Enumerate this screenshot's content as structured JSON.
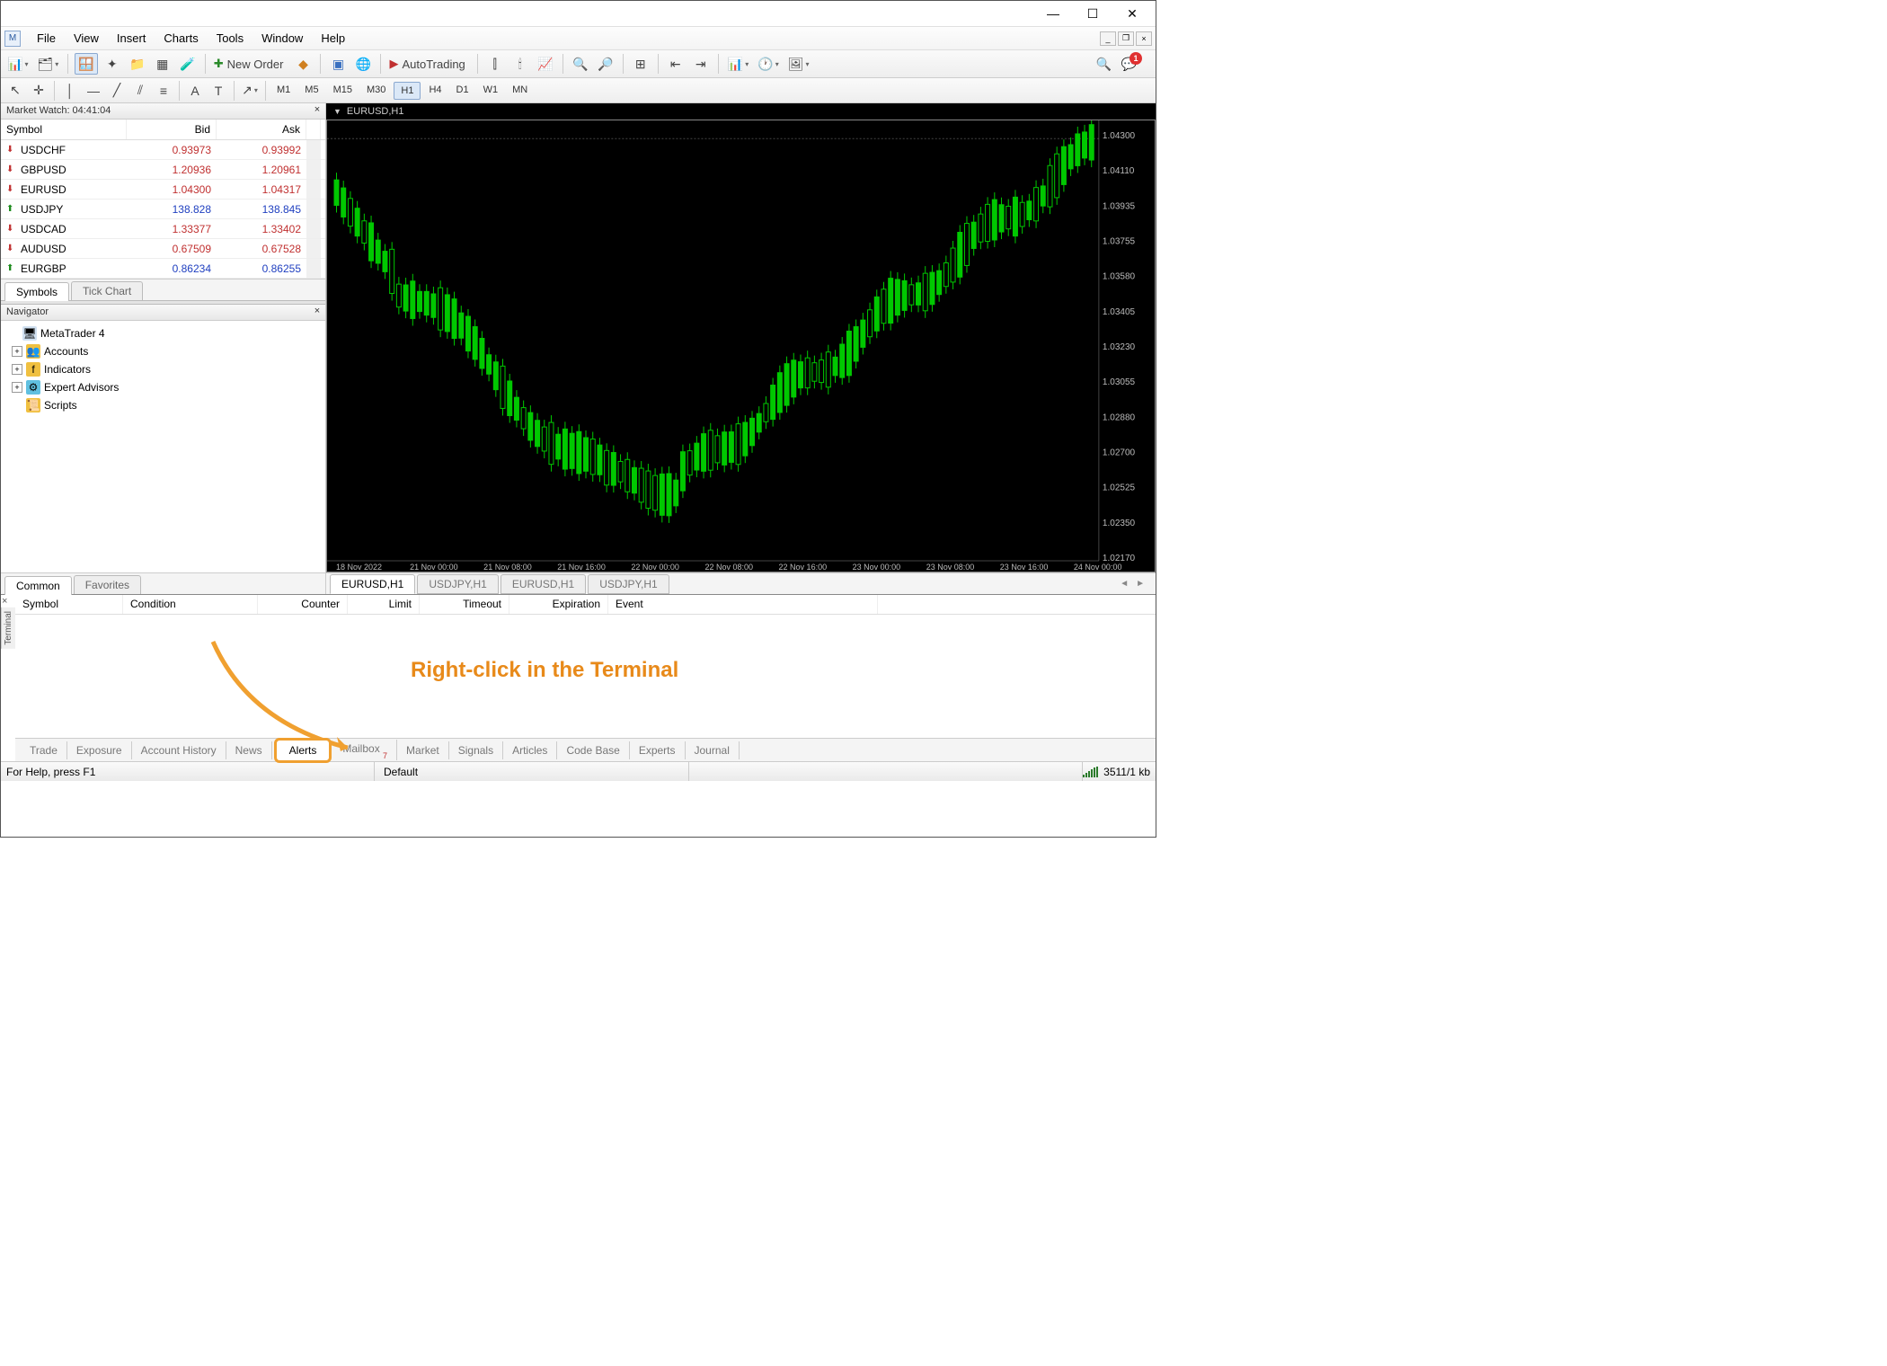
{
  "menu": {
    "items": [
      "File",
      "View",
      "Insert",
      "Charts",
      "Tools",
      "Window",
      "Help"
    ]
  },
  "toolbar": {
    "new_order": "New Order",
    "autotrading": "AutoTrading",
    "notif_count": "1"
  },
  "timeframes": [
    "M1",
    "M5",
    "M15",
    "M30",
    "H1",
    "H4",
    "D1",
    "W1",
    "MN"
  ],
  "timeframe_active": "H1",
  "market_watch": {
    "title": "Market Watch: 04:41:04",
    "cols": {
      "symbol": "Symbol",
      "bid": "Bid",
      "ask": "Ask"
    },
    "rows": [
      {
        "dir": "dn",
        "sym": "USDCHF",
        "bid": "0.93973",
        "ask": "0.93992",
        "cls": "red"
      },
      {
        "dir": "dn",
        "sym": "GBPUSD",
        "bid": "1.20936",
        "ask": "1.20961",
        "cls": "red"
      },
      {
        "dir": "dn",
        "sym": "EURUSD",
        "bid": "1.04300",
        "ask": "1.04317",
        "cls": "red"
      },
      {
        "dir": "up",
        "sym": "USDJPY",
        "bid": "138.828",
        "ask": "138.845",
        "cls": "blue"
      },
      {
        "dir": "dn",
        "sym": "USDCAD",
        "bid": "1.33377",
        "ask": "1.33402",
        "cls": "red"
      },
      {
        "dir": "dn",
        "sym": "AUDUSD",
        "bid": "0.67509",
        "ask": "0.67528",
        "cls": "red"
      },
      {
        "dir": "up",
        "sym": "EURGBP",
        "bid": "0.86234",
        "ask": "0.86255",
        "cls": "blue"
      }
    ],
    "tabs": [
      "Symbols",
      "Tick Chart"
    ]
  },
  "navigator": {
    "title": "Navigator",
    "items": [
      {
        "exp": false,
        "icon": "🖥",
        "label": "MetaTrader 4"
      },
      {
        "exp": true,
        "icon": "👥",
        "iconbg": "#f0c040",
        "label": "Accounts"
      },
      {
        "exp": true,
        "icon": "f",
        "iconbg": "#f0c040",
        "label": "Indicators"
      },
      {
        "exp": true,
        "icon": "⚙",
        "iconbg": "#60c0e0",
        "label": "Expert Advisors"
      },
      {
        "exp": false,
        "icon": "📜",
        "iconbg": "#f0c040",
        "label": "Scripts"
      }
    ],
    "tabs": [
      "Common",
      "Favorites"
    ]
  },
  "chart": {
    "title": "EURUSD,H1",
    "yticks": [
      "1.04300",
      "1.04110",
      "1.03935",
      "1.03755",
      "1.03580",
      "1.03405",
      "1.03230",
      "1.03055",
      "1.02880",
      "1.02700",
      "1.02525",
      "1.02350",
      "1.02170"
    ],
    "xticks": [
      "18 Nov 2022",
      "21 Nov 00:00",
      "21 Nov 08:00",
      "21 Nov 16:00",
      "22 Nov 00:00",
      "22 Nov 08:00",
      "22 Nov 16:00",
      "23 Nov 00:00",
      "23 Nov 08:00",
      "23 Nov 16:00",
      "24 Nov 00:00"
    ],
    "tabs": [
      "EURUSD,H1",
      "USDJPY,H1",
      "EURUSD,H1",
      "USDJPY,H1"
    ]
  },
  "terminal": {
    "label": "Terminal",
    "cols": [
      "Symbol",
      "Condition",
      "Counter",
      "Limit",
      "Timeout",
      "Expiration",
      "Event"
    ],
    "annotation": "Right-click in the Terminal",
    "tabs": [
      "Trade",
      "Exposure",
      "Account History",
      "News",
      "Alerts",
      "Mailbox",
      "Market",
      "Signals",
      "Articles",
      "Code Base",
      "Experts",
      "Journal"
    ],
    "active_tab": "Alerts"
  },
  "status": {
    "help": "For Help, press F1",
    "profile": "Default",
    "net": "3511/1 kb"
  }
}
